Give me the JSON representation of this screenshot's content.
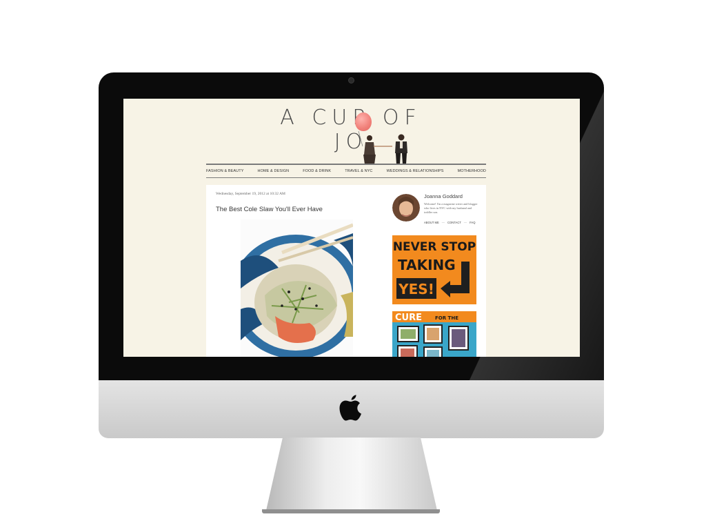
{
  "blog": {
    "title": "A CUP OF JO"
  },
  "nav": {
    "items": [
      {
        "label": "FASHION & BEAUTY"
      },
      {
        "label": "HOME & DESIGN"
      },
      {
        "label": "FOOD & DRINK"
      },
      {
        "label": "TRAVEL & NYC"
      },
      {
        "label": "WEDDINGS & RELATIONSHIPS"
      },
      {
        "label": "MOTHERHOOD"
      }
    ]
  },
  "post": {
    "date": "Wednesday, September 19, 2012 at 10:32 AM",
    "title": "The Best Cole Slaw You'll Ever Have"
  },
  "sidebar": {
    "author_name": "Joanna Goddard",
    "author_bio": "Welcome! I'm a magazine writer and blogger who lives in NYC with my husband and toddler son.",
    "links": {
      "about": "ABOUT ME",
      "contact": "CONTACT",
      "faq": "FAQ",
      "separator": "—"
    },
    "ad1": {
      "line1": "NEVER STOP",
      "line2": "TAKING",
      "line3": "YES!"
    },
    "ad2": {
      "line1": "CURE",
      "line2": "FOR THE"
    }
  },
  "colors": {
    "screen_bg": "#f7f3e6",
    "accent_orange": "#f28a1e",
    "balloon": "#f07f78"
  }
}
